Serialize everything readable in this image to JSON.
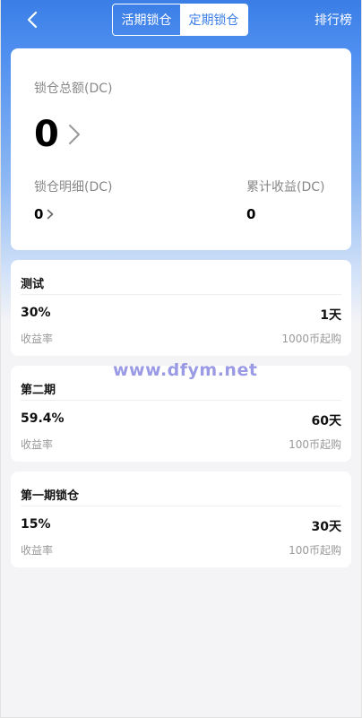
{
  "header": {
    "tabs": [
      {
        "label": "活期锁仓",
        "active": false
      },
      {
        "label": "定期锁仓",
        "active": true
      }
    ],
    "rank_label": "排行榜"
  },
  "summary": {
    "total_label": "锁仓总额(DC)",
    "total_value": "0",
    "detail_label": "锁仓明细(DC)",
    "detail_value": "0",
    "income_label": "累计收益(DC)",
    "income_value": "0"
  },
  "plans": [
    {
      "name": "测试",
      "rate": "30%",
      "days": "1天",
      "rate_label": "收益率",
      "min": "1000币起购"
    },
    {
      "name": "第二期",
      "rate": "59.4%",
      "days": "60天",
      "rate_label": "收益率",
      "min": "100币起购"
    },
    {
      "name": "第一期锁仓",
      "rate": "15%",
      "days": "30天",
      "rate_label": "收益率",
      "min": "100币起购"
    }
  ],
  "watermark": "www.dfym.net",
  "colors": {
    "accent": "#3a7ee6",
    "background": "#f4f4f6"
  },
  "icons": {
    "back": "chevron-left-icon",
    "more": "chevron-right-icon"
  }
}
